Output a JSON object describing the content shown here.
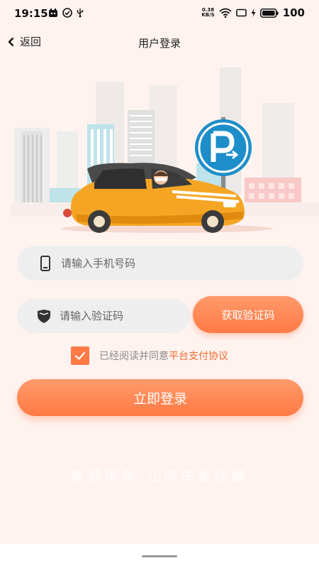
{
  "status": {
    "time": "19:15",
    "net_speed_value": "0.38",
    "net_speed_unit": "KB/S",
    "battery": "100"
  },
  "nav": {
    "back_label": "返回",
    "title": "用户登录"
  },
  "form": {
    "phone_placeholder": "请输入手机号码",
    "code_placeholder": "请输入验证码",
    "get_code_label": "获取验证码",
    "agree_prefix": "已经阅读并同意",
    "agree_link": "平台支付协议",
    "agree_checked": true,
    "login_label": "立即登录"
  },
  "slogan": "智慧停车 让停车更快捷",
  "colors": {
    "accent": "#ff7a45",
    "background": "#fff3f0",
    "field": "#eeeeee",
    "parking_sign": "#1d8ec9",
    "car": "#f5a524"
  },
  "icons": {
    "back": "chevron-left-icon",
    "phone": "phone-icon",
    "shield": "shield-icon",
    "check": "check-icon",
    "parking": "parking-sign-icon"
  }
}
